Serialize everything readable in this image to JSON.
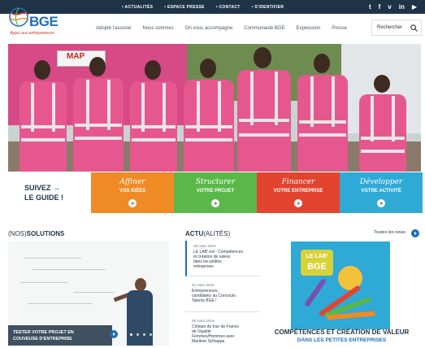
{
  "topbar": {
    "links": [
      "• ACTUALITÉS",
      "• ESPACE PRESSE",
      "• CONTACT",
      "• S'IDENTIFIER"
    ],
    "social": [
      {
        "icon": "twitter-icon",
        "glyph": "t"
      },
      {
        "icon": "facebook-icon",
        "glyph": "f"
      },
      {
        "icon": "vimeo-icon",
        "glyph": "v"
      },
      {
        "icon": "linkedin-icon",
        "glyph": "in"
      },
      {
        "icon": "youtube-icon",
        "glyph": "▶"
      }
    ]
  },
  "logo": {
    "brand": "BGE",
    "tagline": "Appui aux entrepreneurs"
  },
  "nav": {
    "items": [
      "Adopté l'associé",
      "Nous sommes",
      "On vous accompagne",
      "Communauté BGE",
      "Expression",
      "Presse"
    ]
  },
  "search": {
    "label": "Rechercher"
  },
  "hero": {
    "sign_text": "MAP"
  },
  "guide": {
    "intro_line1": "SUIVEZ →",
    "intro_line2": "LE GUIDE !",
    "tiles": [
      {
        "title": "Affiner",
        "subtitle": "VOS IDÉES",
        "color": "#f08a24"
      },
      {
        "title": "Structurer",
        "subtitle": "VOTRE PROJET",
        "color": "#5ab849"
      },
      {
        "title": "Financer",
        "subtitle": "VOTRE ENTREPRISE",
        "color": "#e2442f"
      },
      {
        "title": "Développer",
        "subtitle": "VOTRE ACTIVITÉ",
        "color": "#2fa9d6"
      }
    ]
  },
  "solutions": {
    "title_prefix": "(NOS)",
    "title_main": "SOLUTIONS",
    "caption_line1": "TESTER VOTRE PROJET EN",
    "caption_line2": "COUVEUSE D'ENTREPRISE"
  },
  "actu": {
    "title_main": "ACTU",
    "title_suffix": "(ALITÉS)",
    "all_news": "Toutes les news",
    "items": [
      {
        "date": "08 mars 2019",
        "lines": [
          "LE LAB' est : Compétences",
          "et création de valeur",
          "dans les petites",
          "entreprises"
        ]
      },
      {
        "date": "01 mars 2019",
        "lines": [
          "Entrepreneurs,",
          "candidatez au Concours",
          "Talents BGE !"
        ]
      },
      {
        "date": "08 mars 2019",
        "lines": [
          "Critique du tour de France",
          "de l'égalité",
          "Femmes/Hommes avec",
          "Marlène Schiappa"
        ]
      }
    ]
  },
  "promo": {
    "badge_line1": "LE LAB'",
    "badge_line2": "BGE",
    "caption_line1": "COMPÉTENCES ET CRÉATION DE VALEUR",
    "caption_line2": "DANS LES PETITES ENTREPRISES"
  }
}
